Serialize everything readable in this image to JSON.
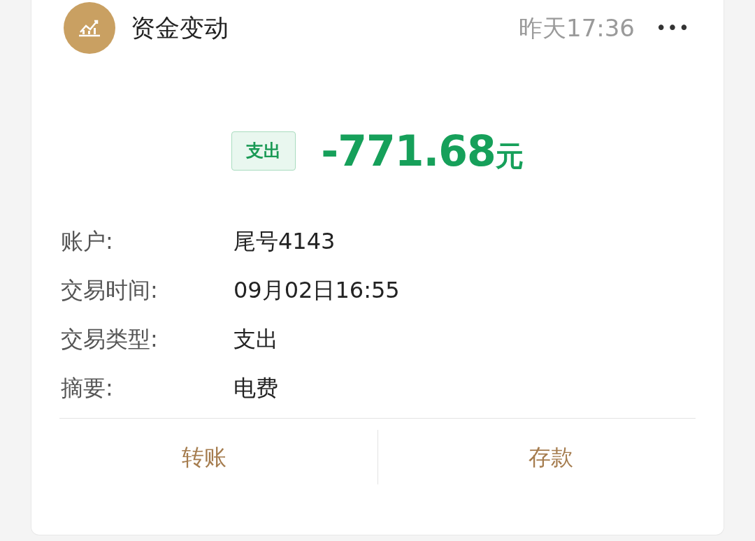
{
  "header": {
    "title": "资金变动",
    "time": "昨天17:36",
    "more": "•••"
  },
  "amount": {
    "badge": "支出",
    "value": "-771.68",
    "unit": "元"
  },
  "details": [
    {
      "label": "账户:",
      "value": "尾号4143"
    },
    {
      "label": "交易时间:",
      "value": "09月02日16:55"
    },
    {
      "label": "交易类型:",
      "value": "支出"
    },
    {
      "label": "摘要:",
      "value": "电费"
    }
  ],
  "actions": [
    {
      "label": "转账"
    },
    {
      "label": "存款"
    }
  ]
}
